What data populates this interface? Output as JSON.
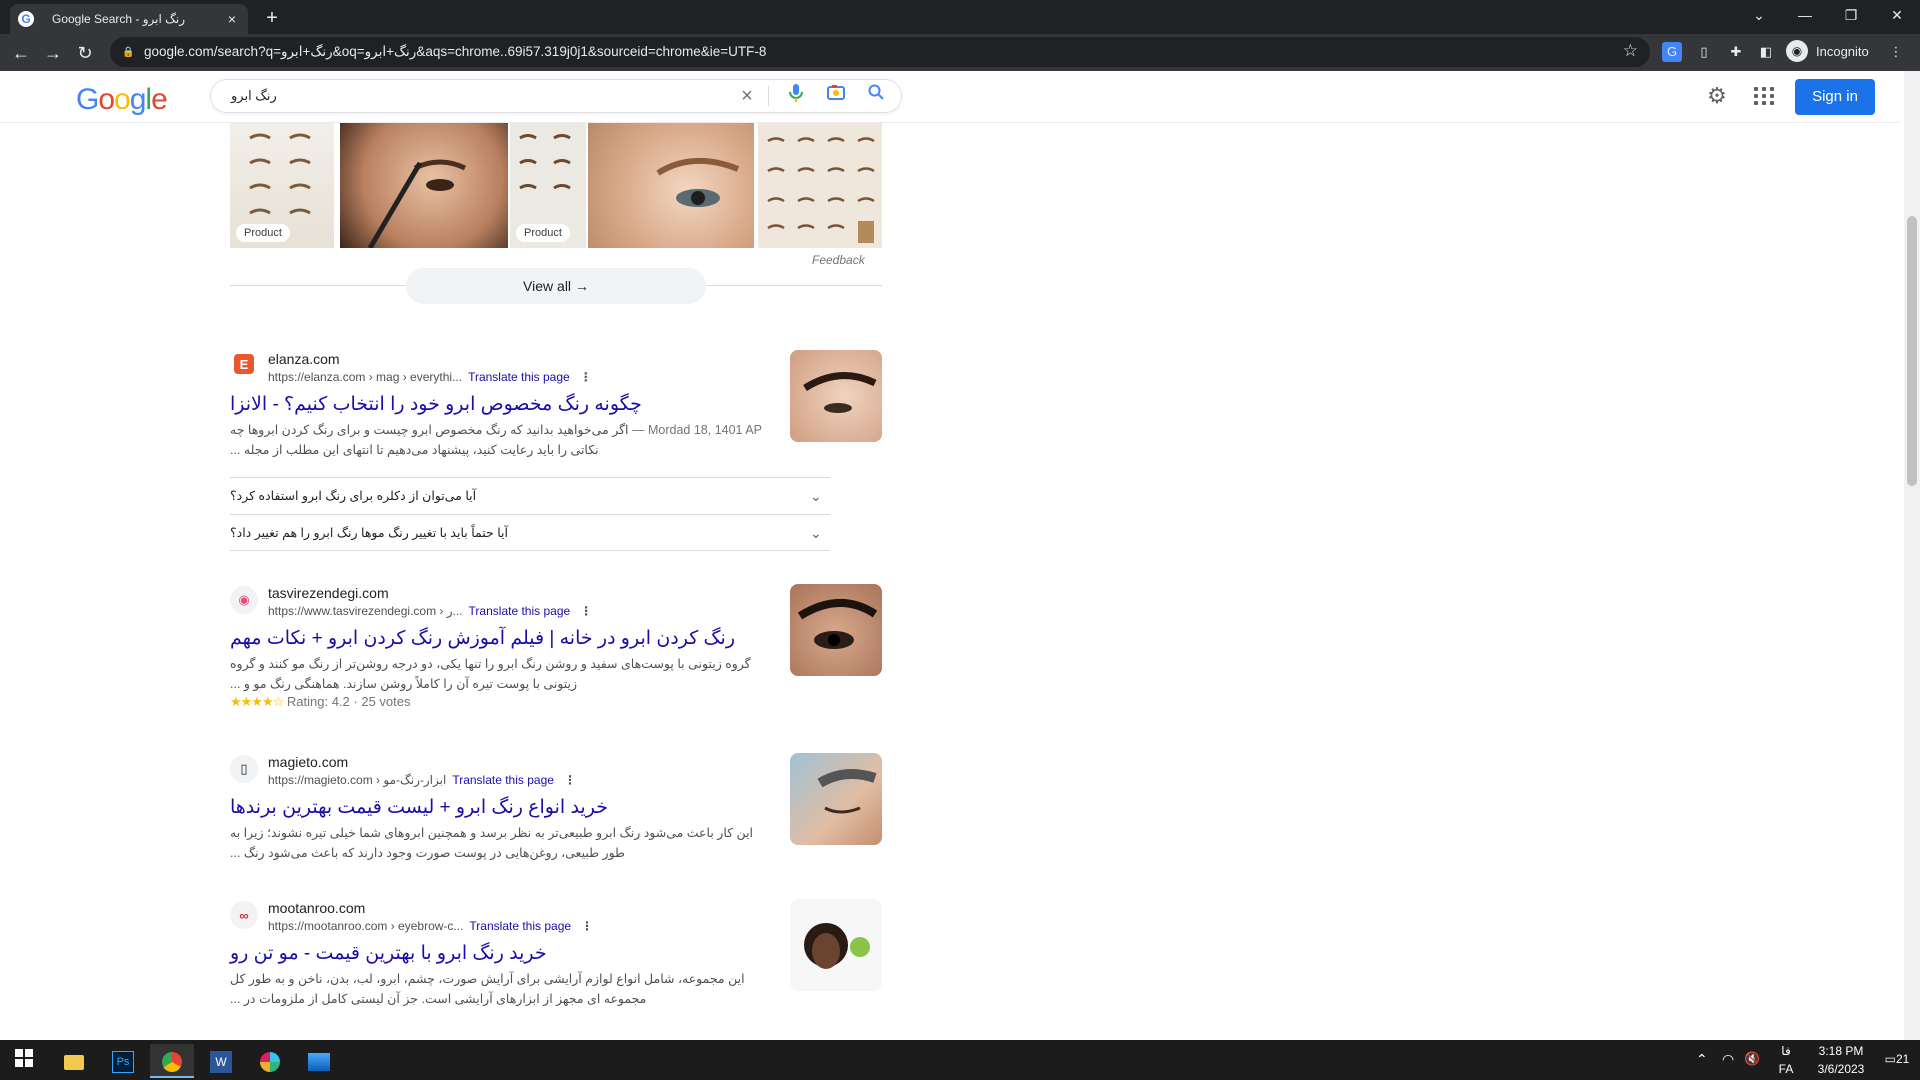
{
  "browser": {
    "tab_title": "Google Search - رنگ ابرو",
    "tab_close": "×",
    "new_tab": "+",
    "url": "google.com/search?q=رنگ+ابرو&oq=رنگ+ابرو&aqs=chrome..69i57.319j0j1&sourceid=chrome&ie=UTF-8",
    "profile": "Incognito"
  },
  "google": {
    "query": "رنگ ابرو",
    "sign_in": "Sign in"
  },
  "images": {
    "badge1": "Product",
    "badge2": "Product",
    "feedback": "Feedback",
    "view_all": "View all"
  },
  "results": [
    {
      "site": "elanza.com",
      "url": "https://elanza.com › mag › everythi...",
      "translate": "Translate this page",
      "title": "چگونه رنگ مخصوص ابرو خود را انتخاب کنیم؟ - الانزا",
      "date": "Mordad 18, 1401 AP —",
      "snippet": "اگر می‌خواهید بدانید که رنگ مخصوص ابرو چیست و برای رنگ کردن ابروها چه نکاتی را باید رعایت کنید، پیشنهاد می‌دهیم تا انتهای این مطلب از مجله ..."
    },
    {
      "site": "tasvirezendegi.com",
      "url": "https://www.tasvirezendegi.com › ر...",
      "translate": "Translate this page",
      "title": "رنگ کردن ابرو در خانه | فیلم آموزش رنگ کردن ابرو + نکات مهم",
      "snippet": "گروه زیتونی با پوست‌های سفید و روشن رنگ ابرو را تنها یکی، دو درجه روشن‌تر از رنگ مو کنند و گروه زیتونی با پوست تیره آن را کاملاً روشن سازند. هماهنگی رنگ مو و ...",
      "stars": "★★★★☆",
      "rating": "Rating: 4.2 · 25 votes"
    },
    {
      "site": "magieto.com",
      "url": "https://magieto.com › ابزار-رنگ-مو",
      "translate": "Translate this page",
      "title": "خرید انواع رنگ ابرو + لیست قیمت بهترین برندها",
      "snippet": "این کار باعث می‌شود رنگ ابرو طبیعی‌تر به نظر برسد و همچنین ابروهای شما خیلی تیره نشوند؛ زیرا به طور طبیعی، روغن‌هایی در پوست صورت وجود دارند که باعث می‌شود رنگ ..."
    },
    {
      "site": "mootanroo.com",
      "url": "https://mootanroo.com › eyebrow-c...",
      "translate": "Translate this page",
      "title": "خرید رنگ ابرو با بهترین قیمت - مو تن رو",
      "snippet": "این مجموعه، شامل انواع لوازم آرایشی برای آرایش صورت، چشم، ابرو، لب، بدن، ناخن و به طور کل مجموعه ای مجهز از ابزارهای آرایشی است. جز آن لیستی کامل از ملزومات در ..."
    }
  ],
  "faq": [
    "آیا می‌توان از دکلره برای رنگ ابرو استفاده کرد؟",
    "آیا حتماً باید با تغییر رنگ موها رنگ ابرو را هم تغییر داد؟"
  ],
  "taskbar": {
    "time": "3:18 PM",
    "date": "3/6/2023",
    "lang": "فا",
    "lang2": "FA",
    "notif": "21"
  }
}
